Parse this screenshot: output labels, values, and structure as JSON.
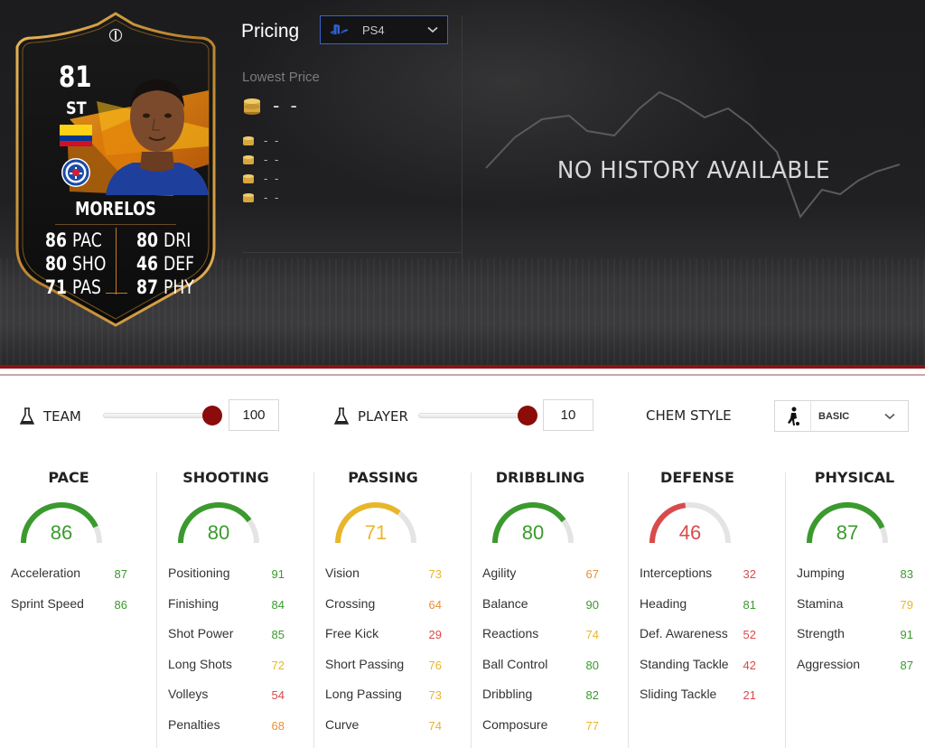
{
  "colors": {
    "green": "#3b9a2e",
    "yellow": "#e8b62b",
    "orange": "#e8923a",
    "red": "#d84b4b",
    "gauge_track": "#e4e4e4",
    "accent_red": "#8c0b0b"
  },
  "card": {
    "rating": "81",
    "position": "ST",
    "name": "MORELOS",
    "nation_flag": "colombia-flag",
    "club_badge": "rangers-badge",
    "stats_left": [
      {
        "value": "86",
        "label": "PAC"
      },
      {
        "value": "80",
        "label": "SHO"
      },
      {
        "value": "71",
        "label": "PAS"
      }
    ],
    "stats_right": [
      {
        "value": "80",
        "label": "DRI"
      },
      {
        "value": "46",
        "label": "DEF"
      },
      {
        "value": "87",
        "label": "PHY"
      }
    ]
  },
  "pricing": {
    "title": "Pricing",
    "platform": "PS4",
    "lowest_label": "Lowest Price",
    "lowest_value": "- -",
    "other_prices": [
      "- -",
      "- -",
      "- -",
      "- -"
    ],
    "no_history": "NO HISTORY AVAILABLE"
  },
  "chemistry": {
    "team_label": "TEAM",
    "team_value": "100",
    "team_level": 1.0,
    "player_label": "PLAYER",
    "player_value": "10",
    "player_level": 1.0,
    "style_label": "CHEM STYLE",
    "style_value": "BASIC"
  },
  "categories": [
    {
      "title": "PACE",
      "value": 86,
      "value_text": "86",
      "color": "green",
      "attrs": [
        {
          "name": "Acceleration",
          "value": "87",
          "color": "green"
        },
        {
          "name": "Sprint Speed",
          "value": "86",
          "color": "green"
        }
      ]
    },
    {
      "title": "SHOOTING",
      "value": 80,
      "value_text": "80",
      "color": "green",
      "attrs": [
        {
          "name": "Positioning",
          "value": "91",
          "color": "green"
        },
        {
          "name": "Finishing",
          "value": "84",
          "color": "green"
        },
        {
          "name": "Shot Power",
          "value": "85",
          "color": "green"
        },
        {
          "name": "Long Shots",
          "value": "72",
          "color": "yellow"
        },
        {
          "name": "Volleys",
          "value": "54",
          "color": "red"
        },
        {
          "name": "Penalties",
          "value": "68",
          "color": "orange"
        }
      ]
    },
    {
      "title": "PASSING",
      "value": 71,
      "value_text": "71",
      "color": "yellow",
      "attrs": [
        {
          "name": "Vision",
          "value": "73",
          "color": "yellow"
        },
        {
          "name": "Crossing",
          "value": "64",
          "color": "orange"
        },
        {
          "name": "Free Kick",
          "value": "29",
          "color": "red"
        },
        {
          "name": "Short Passing",
          "value": "76",
          "color": "yellow"
        },
        {
          "name": "Long Passing",
          "value": "73",
          "color": "yellow"
        },
        {
          "name": "Curve",
          "value": "74",
          "color": "yellow"
        }
      ]
    },
    {
      "title": "DRIBBLING",
      "value": 80,
      "value_text": "80",
      "color": "green",
      "attrs": [
        {
          "name": "Agility",
          "value": "67",
          "color": "orange"
        },
        {
          "name": "Balance",
          "value": "90",
          "color": "green"
        },
        {
          "name": "Reactions",
          "value": "74",
          "color": "yellow"
        },
        {
          "name": "Ball Control",
          "value": "80",
          "color": "green"
        },
        {
          "name": "Dribbling",
          "value": "82",
          "color": "green"
        },
        {
          "name": "Composure",
          "value": "77",
          "color": "yellow"
        }
      ]
    },
    {
      "title": "DEFENSE",
      "value": 46,
      "value_text": "46",
      "color": "red",
      "attrs": [
        {
          "name": "Interceptions",
          "value": "32",
          "color": "red"
        },
        {
          "name": "Heading",
          "value": "81",
          "color": "green"
        },
        {
          "name": "Def. Awareness",
          "value": "52",
          "color": "red"
        },
        {
          "name": "Standing Tackle",
          "value": "42",
          "color": "red"
        },
        {
          "name": "Sliding Tackle",
          "value": "21",
          "color": "red"
        }
      ]
    },
    {
      "title": "PHYSICAL",
      "value": 87,
      "value_text": "87",
      "color": "green",
      "attrs": [
        {
          "name": "Jumping",
          "value": "83",
          "color": "green"
        },
        {
          "name": "Stamina",
          "value": "79",
          "color": "yellow"
        },
        {
          "name": "Strength",
          "value": "91",
          "color": "green"
        },
        {
          "name": "Aggression",
          "value": "87",
          "color": "green"
        }
      ]
    }
  ]
}
